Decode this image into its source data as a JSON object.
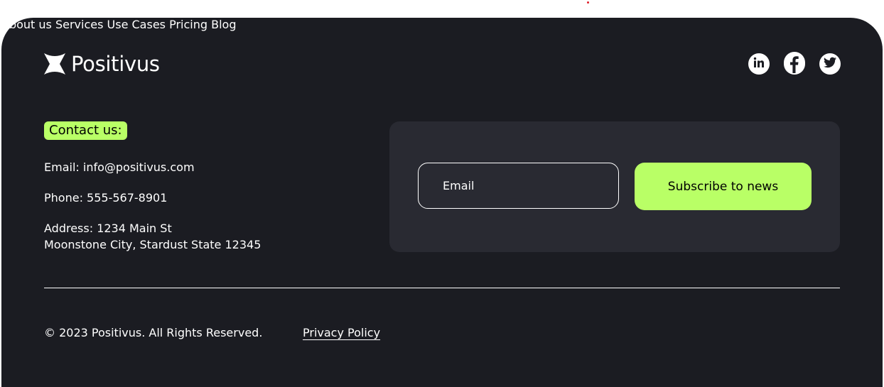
{
  "brand": {
    "name": "Positivus",
    "logo_icon": "positivus-star-icon"
  },
  "nav": {
    "items": [
      {
        "label": "About us"
      },
      {
        "label": "Services"
      },
      {
        "label": "Use Cases"
      },
      {
        "label": "Pricing"
      },
      {
        "label": "Blog"
      }
    ]
  },
  "social": {
    "items": [
      {
        "icon": "linkedin-icon"
      },
      {
        "icon": "facebook-icon"
      },
      {
        "icon": "twitter-icon"
      }
    ]
  },
  "contact": {
    "heading": "Contact us:",
    "email": "Email: info@positivus.com",
    "phone": "Phone: 555-567-8901",
    "address_line1": "Address: 1234 Main St",
    "address_line2": "Moonstone City, Stardust State 12345"
  },
  "subscribe": {
    "placeholder": "Email",
    "button_label": "Subscribe to news"
  },
  "bottom": {
    "copyright": "© 2023 Positivus. All Rights Reserved.",
    "privacy_label": "Privacy Policy"
  },
  "colors": {
    "background": "#1b1c22",
    "panel": "#292a32",
    "accent": "#b9ff66",
    "text": "#ffffff"
  }
}
